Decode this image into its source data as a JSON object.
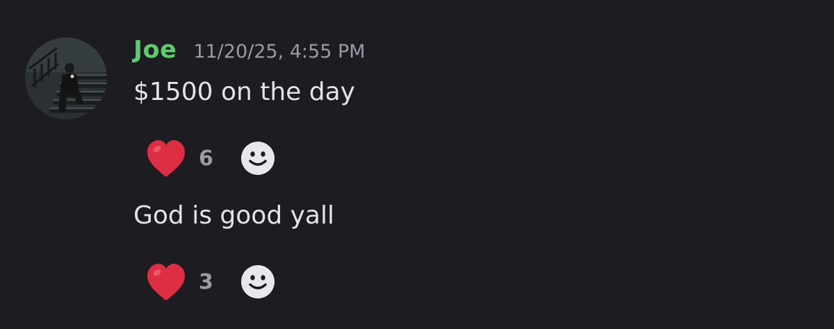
{
  "message_group": {
    "username": "Joe",
    "timestamp": "11/20/25, 4:55 PM",
    "username_color": "#5fcb6f",
    "avatar_icon": "user-avatar-photo"
  },
  "messages": [
    {
      "text": "$1500 on the day",
      "reaction": {
        "emoji": "❤️",
        "icon": "heart-icon",
        "count": "6"
      },
      "add_reaction_icon": "smiley-face-icon"
    },
    {
      "text": "God is good yall",
      "reaction": {
        "emoji": "❤️",
        "icon": "heart-icon",
        "count": "3"
      },
      "add_reaction_icon": "smiley-face-icon"
    }
  ]
}
